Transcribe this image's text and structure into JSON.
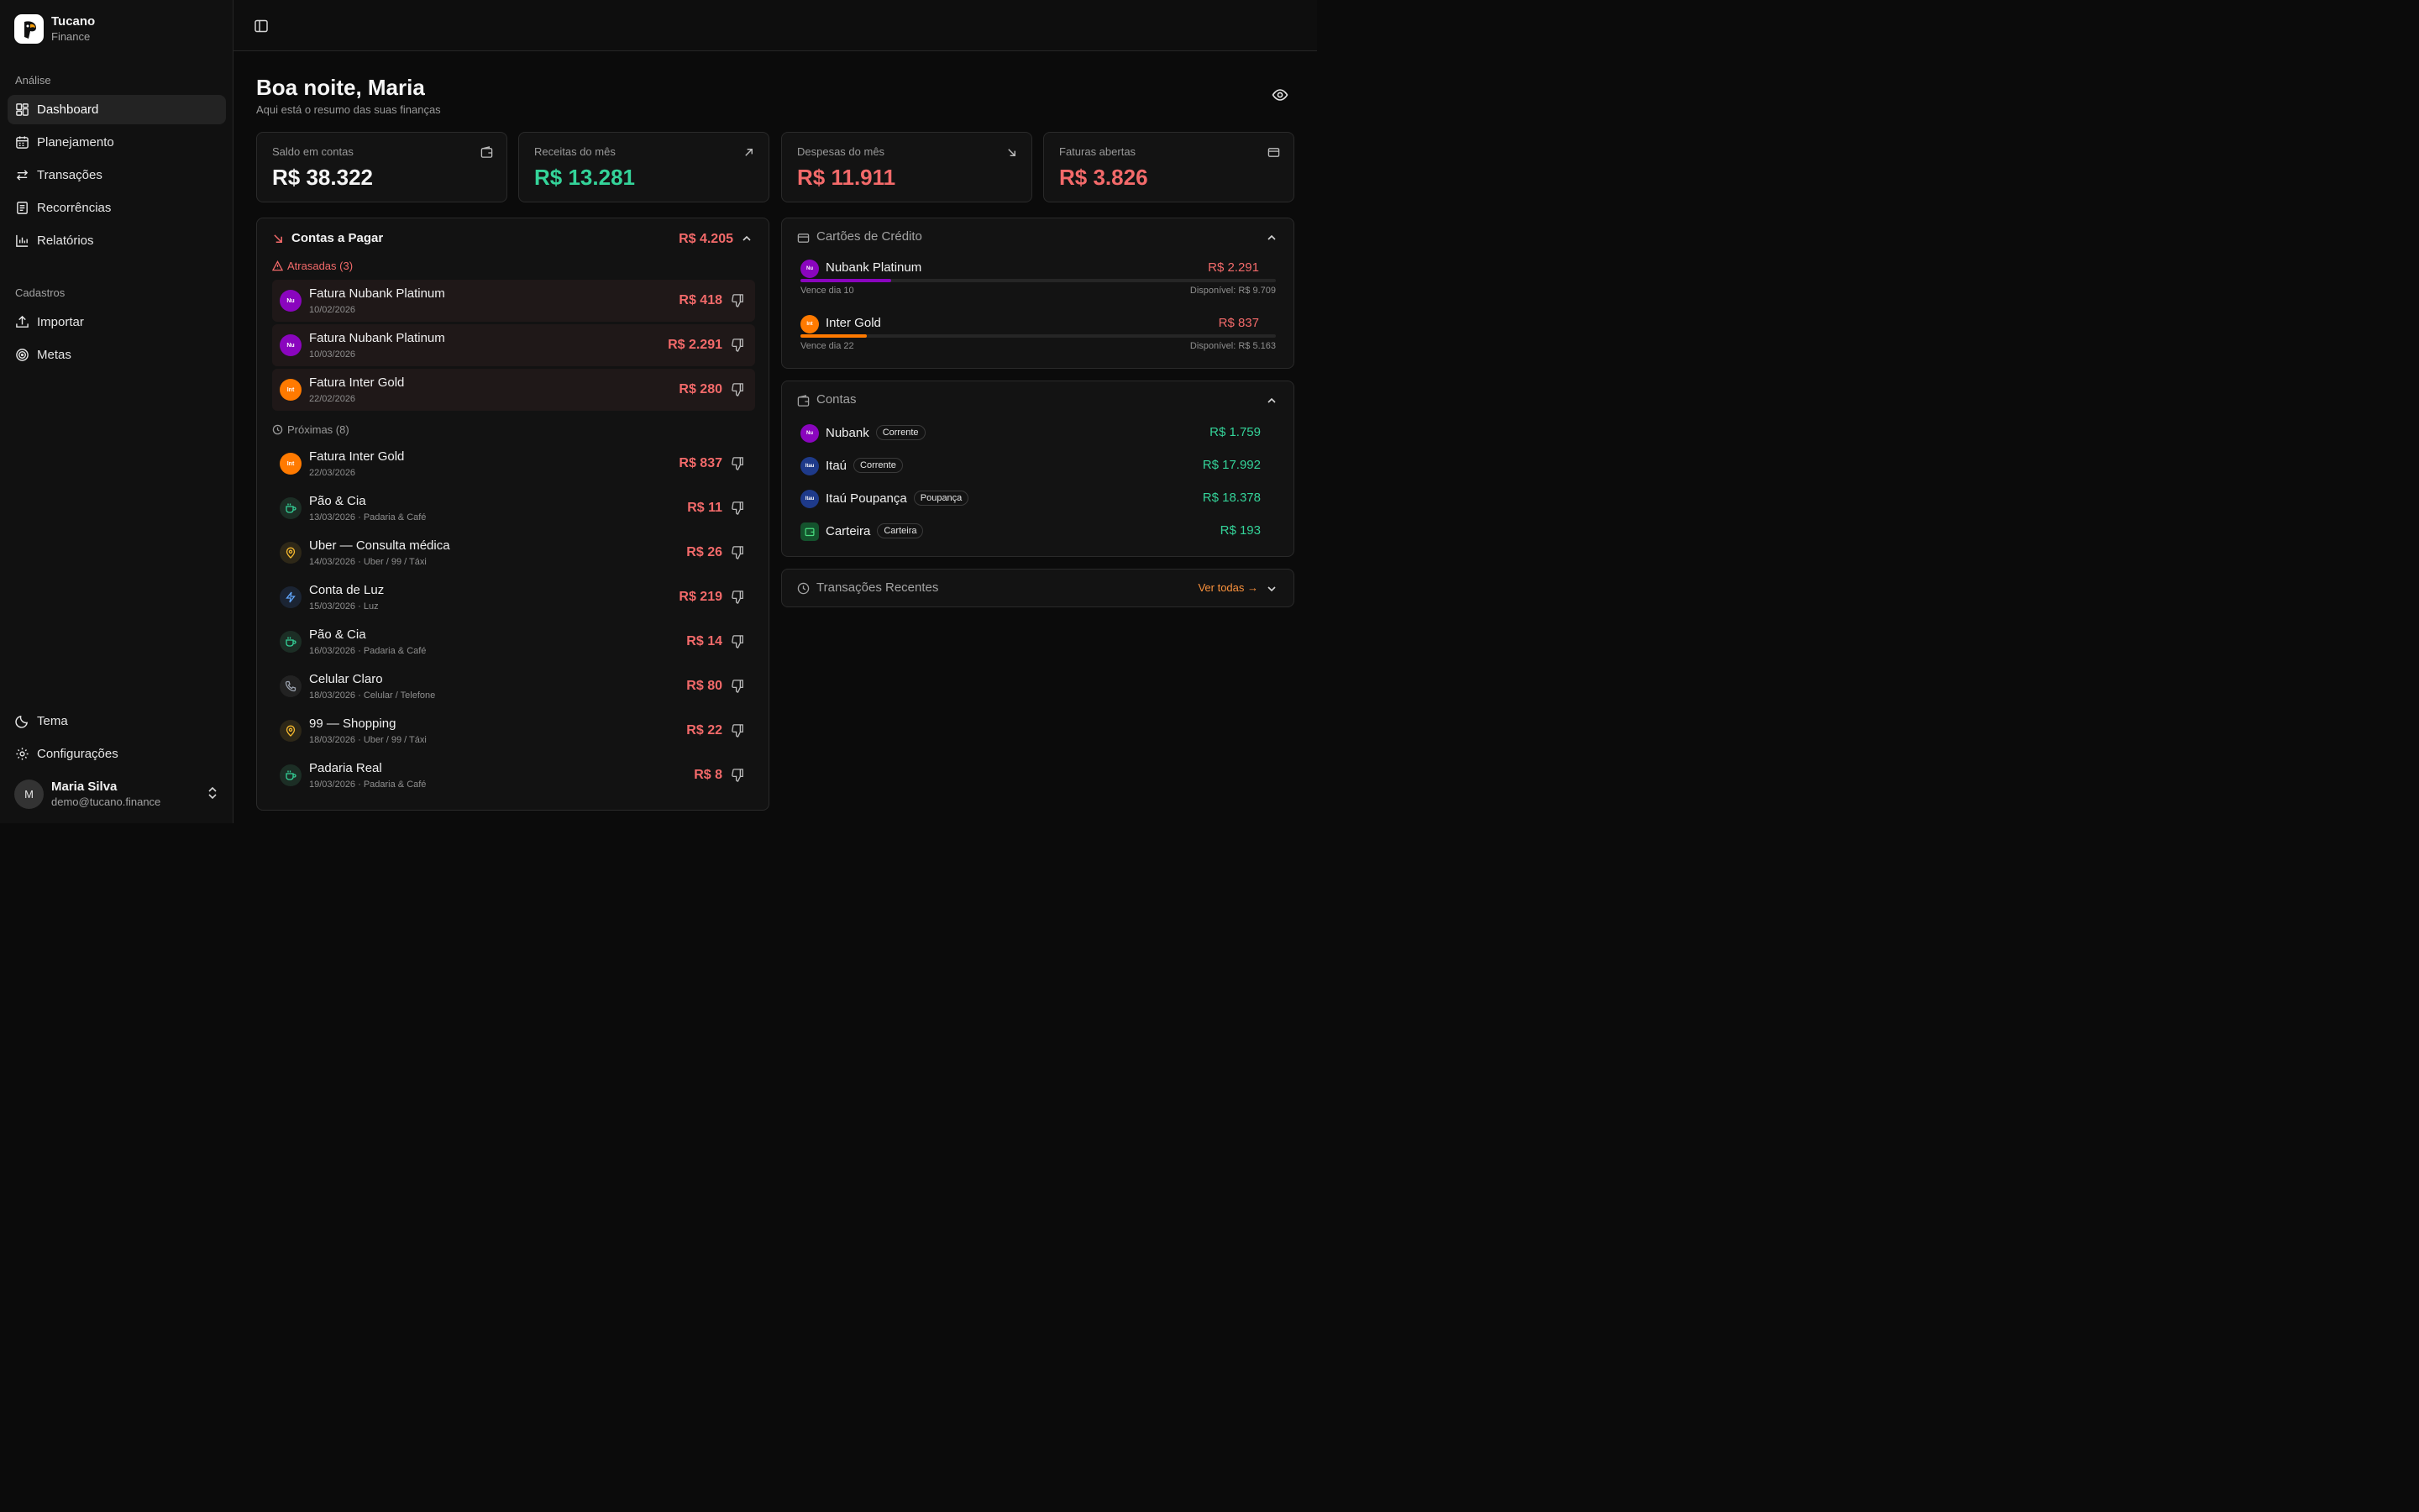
{
  "brand": {
    "name": "Tucano",
    "subtitle": "Finance"
  },
  "sidebar": {
    "section_analysis": "Análise",
    "analysis_items": [
      {
        "label": "Dashboard",
        "icon": "dashboard-icon",
        "active": true
      },
      {
        "label": "Planejamento",
        "icon": "calendar-icon"
      },
      {
        "label": "Transações",
        "icon": "arrows-icon"
      },
      {
        "label": "Recorrências",
        "icon": "document-icon"
      },
      {
        "label": "Relatórios",
        "icon": "bar-chart-icon"
      }
    ],
    "section_records": "Cadastros",
    "record_items": [
      {
        "label": "Importar",
        "icon": "upload-icon"
      },
      {
        "label": "Metas",
        "icon": "target-icon"
      }
    ],
    "bottom_items": [
      {
        "label": "Tema",
        "icon": "moon-icon"
      },
      {
        "label": "Configurações",
        "icon": "gear-icon"
      }
    ],
    "user": {
      "initial": "M",
      "name": "Maria Silva",
      "email": "demo@tucano.finance"
    }
  },
  "header": {
    "greeting": "Boa noite, Maria",
    "subtitle": "Aqui está o resumo das suas finanças"
  },
  "stats": [
    {
      "label": "Saldo em contas",
      "value": "R$ 38.322",
      "color": "#f5f5f5",
      "icon": "wallet-icon"
    },
    {
      "label": "Receitas do mês",
      "value": "R$ 13.281",
      "color": "#34d399",
      "icon": "arrow-up-right-icon"
    },
    {
      "label": "Despesas do mês",
      "value": "R$ 11.911",
      "color": "#f36a6a",
      "icon": "arrow-down-right-icon"
    },
    {
      "label": "Faturas abertas",
      "value": "R$ 3.826",
      "color": "#f36a6a",
      "icon": "credit-card-icon"
    }
  ],
  "bills": {
    "title": "Contas a Pagar",
    "total": "R$ 4.205",
    "overdue_label": "Atrasadas (3)",
    "upcoming_label": "Próximas (8)",
    "overdue": [
      {
        "title": "Fatura Nubank Platinum",
        "sub": "10/02/2026",
        "amount": "R$ 418",
        "badge": "Nu",
        "badge_color": "#8a05be"
      },
      {
        "title": "Fatura Nubank Platinum",
        "sub": "10/03/2026",
        "amount": "R$ 2.291",
        "badge": "Nu",
        "badge_color": "#8a05be"
      },
      {
        "title": "Fatura Inter Gold",
        "sub": "22/02/2026",
        "amount": "R$ 280",
        "badge": "Int",
        "badge_color": "#ff7a00"
      }
    ],
    "upcoming": [
      {
        "title": "Fatura Inter Gold",
        "sub": "22/03/2026",
        "amount": "R$ 837",
        "badge": "Int",
        "badge_color": "#ff7a00",
        "icon": ""
      },
      {
        "title": "Pão & Cia",
        "sub": "13/03/2026 · Padaria & Café",
        "amount": "R$ 11",
        "icon": "coffee-icon",
        "icon_color": "#34d399"
      },
      {
        "title": "Uber — Consulta médica",
        "sub": "14/03/2026 · Uber / 99 / Táxi",
        "amount": "R$ 26",
        "icon": "map-pin-icon",
        "icon_color": "#f5b82e"
      },
      {
        "title": "Conta de Luz",
        "sub": "15/03/2026 · Luz",
        "amount": "R$ 219",
        "icon": "zap-icon",
        "icon_color": "#60a5fa"
      },
      {
        "title": "Pão & Cia",
        "sub": "16/03/2026 · Padaria & Café",
        "amount": "R$ 14",
        "icon": "coffee-icon",
        "icon_color": "#34d399"
      },
      {
        "title": "Celular Claro",
        "sub": "18/03/2026 · Celular / Telefone",
        "amount": "R$ 80",
        "icon": "phone-icon",
        "icon_color": "#9ca3af"
      },
      {
        "title": "99 — Shopping",
        "sub": "18/03/2026 · Uber / 99 / Táxi",
        "amount": "R$ 22",
        "icon": "map-pin-icon",
        "icon_color": "#f5b82e"
      },
      {
        "title": "Padaria Real",
        "sub": "19/03/2026 · Padaria & Café",
        "amount": "R$ 8",
        "icon": "coffee-icon",
        "icon_color": "#34d399"
      }
    ]
  },
  "cards": {
    "title": "Cartões de Crédito",
    "items": [
      {
        "name": "Nubank Platinum",
        "amount": "R$ 2.291",
        "due": "Vence dia 10",
        "available": "Disponível: R$ 9.709",
        "badge": "Nu",
        "color": "#8a05be",
        "usage": 0.19
      },
      {
        "name": "Inter Gold",
        "amount": "R$ 837",
        "due": "Vence dia 22",
        "available": "Disponível: R$ 5.163",
        "badge": "Int",
        "color": "#ff7a00",
        "usage": 0.14
      }
    ]
  },
  "accounts": {
    "title": "Contas",
    "items": [
      {
        "name": "Nubank",
        "type": "Corrente",
        "amount": "R$ 1.759",
        "badge": "Nu",
        "color": "#8a05be"
      },
      {
        "name": "Itaú",
        "type": "Corrente",
        "amount": "R$ 17.992",
        "badge": "Itau",
        "color": "#1e3a8a"
      },
      {
        "name": "Itaú Poupança",
        "type": "Poupança",
        "amount": "R$ 18.378",
        "badge": "Itau",
        "color": "#1e3a8a"
      },
      {
        "name": "Carteira",
        "type": "Carteira",
        "amount": "R$ 193",
        "badge": "",
        "color": "#14532d"
      }
    ]
  },
  "recent": {
    "title": "Transações Recentes",
    "link": "Ver todas →"
  }
}
